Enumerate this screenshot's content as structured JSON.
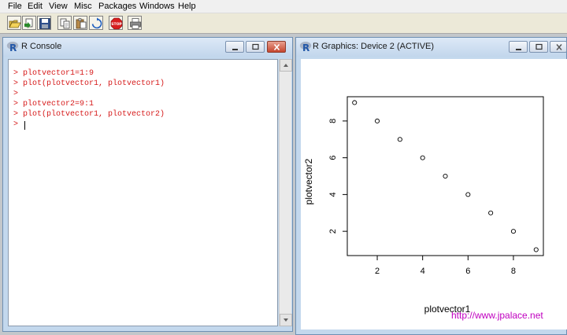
{
  "menubar": {
    "items": [
      "File",
      "Edit",
      "View",
      "Misc",
      "Packages",
      "Windows",
      "Help"
    ]
  },
  "toolbar": {
    "buttons": [
      "open-script-icon",
      "load-workspace-icon",
      "save-workspace-icon",
      "copy-icon",
      "paste-icon",
      "copy-paste-icon",
      "stop-icon",
      "print-icon"
    ],
    "stop_label": "STOP"
  },
  "console_window": {
    "title": "R Console",
    "lines": [
      {
        "prompt": ">",
        "text": "plotvector1=1:9"
      },
      {
        "prompt": ">",
        "text": "plot(plotvector1, plotvector1)"
      },
      {
        "prompt": ">",
        "text": ""
      },
      {
        "prompt": ">",
        "text": "plotvector2=9:1"
      },
      {
        "prompt": ">",
        "text": "plot(plotvector1, plotvector2)"
      },
      {
        "prompt": ">",
        "text": ""
      }
    ]
  },
  "graphics_window": {
    "title": "R Graphics: Device 2 (ACTIVE)",
    "watermark": "http://www.jpalace.net"
  },
  "colors": {
    "console_text": "#d61a1a",
    "watermark": "#c000c0",
    "title_bar": "#c2d6ec"
  },
  "chart_data": {
    "type": "scatter",
    "x": [
      1,
      2,
      3,
      4,
      5,
      6,
      7,
      8,
      9
    ],
    "y": [
      9,
      8,
      7,
      6,
      5,
      4,
      3,
      2,
      1
    ],
    "xlabel": "plotvector1",
    "ylabel": "plotvector2",
    "xticks": [
      2,
      4,
      6,
      8
    ],
    "yticks": [
      2,
      4,
      6,
      8
    ],
    "xlim": [
      0.68,
      9.32
    ],
    "ylim": [
      0.68,
      9.32
    ],
    "grid": false,
    "marker": "open-circle"
  }
}
